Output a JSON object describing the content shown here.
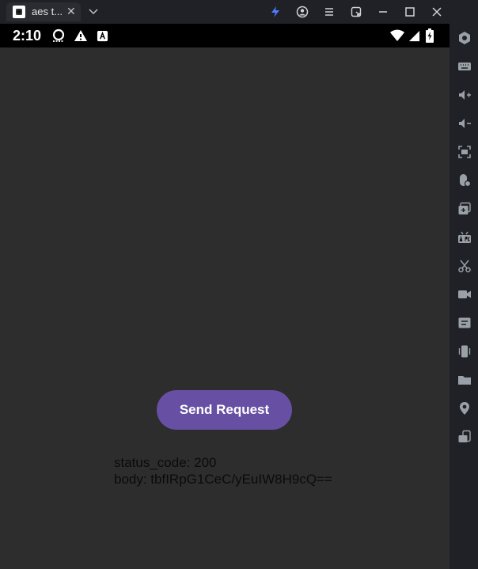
{
  "window": {
    "tab_title": "aes t...",
    "tab_close": "✕",
    "dropdown": "chevron-down-icon"
  },
  "status_bar": {
    "time": "2:10"
  },
  "app": {
    "send_button": "Send Request",
    "status_line": "status_code: 200",
    "body_line": "body: tbfIRpG1CeC/yEuIW8H9cQ=="
  },
  "colors": {
    "accent": "#6750a4",
    "background": "#2d2d2d",
    "statusbar": "#000000",
    "chrome": "#1f2126"
  }
}
